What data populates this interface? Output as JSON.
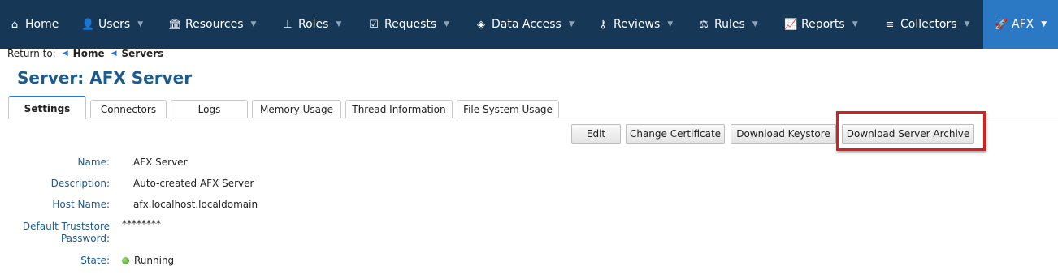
{
  "nav": {
    "items": [
      {
        "label": "Home",
        "icon": "home-icon"
      },
      {
        "label": "Users",
        "icon": "users-icon"
      },
      {
        "label": "Resources",
        "icon": "bank-icon"
      },
      {
        "label": "Roles",
        "icon": "sitemap-icon"
      },
      {
        "label": "Requests",
        "icon": "checkbox-icon"
      },
      {
        "label": "Data Access",
        "icon": "layers-icon"
      },
      {
        "label": "Reviews",
        "icon": "key-icon"
      },
      {
        "label": "Rules",
        "icon": "scale-icon"
      },
      {
        "label": "Reports",
        "icon": "chart-icon"
      },
      {
        "label": "Collectors",
        "icon": "database-icon"
      },
      {
        "label": "AFX",
        "icon": "rocket-icon"
      }
    ],
    "active": "AFX",
    "colors": {
      "bar": "#173757",
      "active": "#2b78c5"
    }
  },
  "breadcrumb": {
    "prefix": "Return to:",
    "items": [
      "Home",
      "Servers"
    ]
  },
  "page_title": "Server: AFX Server",
  "tabs": [
    "Settings",
    "Connectors",
    "Logs",
    "Memory Usage",
    "Thread Information",
    "File System Usage"
  ],
  "active_tab": "Settings",
  "actions": {
    "edit": "Edit",
    "change_cert": "Change Certificate",
    "download_keystore": "Download Keystore",
    "download_archive": "Download Server Archive"
  },
  "details": {
    "name_label": "Name:",
    "name_value": "AFX Server",
    "desc_label": "Description:",
    "desc_value": "Auto-created AFX Server",
    "host_label": "Host Name:",
    "host_value": "afx.localhost.localdomain",
    "trust_label_1": "Default Truststore",
    "trust_label_2": "Password:",
    "trust_value": "********",
    "state_label": "State:",
    "state_value": "Running",
    "state_color": "#3e9a1f"
  }
}
